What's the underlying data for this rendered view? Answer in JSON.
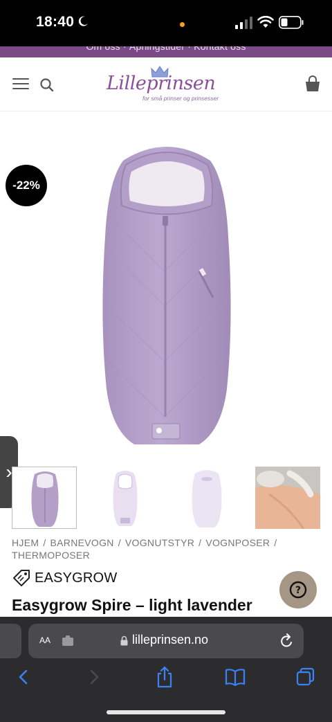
{
  "status_bar": {
    "time": "18:40"
  },
  "top_strip": {
    "links_text": "Om oss  ·  Åpningstider  ·  Kontakt oss"
  },
  "header": {
    "logo_text": "Lilleprinsen",
    "logo_tagline": "for små prinser og prinsesser"
  },
  "product": {
    "discount": "-22%",
    "side_tab_glyph": "›",
    "color": "#b39fc8"
  },
  "breadcrumb": {
    "items": [
      "HJEM",
      "BARNEVOGN",
      "VOGNUTSTYR",
      "VOGNPOSER",
      "THERMOPOSER"
    ],
    "separator": "/"
  },
  "brand": {
    "name": "EASYGROW"
  },
  "help": {
    "glyph": "?"
  },
  "title": "Easygrow Spire – light lavender",
  "browser": {
    "aa_label": "AA",
    "url": "lilleprinsen.no"
  },
  "colors": {
    "brand_purple": "#7a4a87",
    "safari_bar": "#2c2c2e",
    "toolbar_icon": "#3b82f6"
  }
}
